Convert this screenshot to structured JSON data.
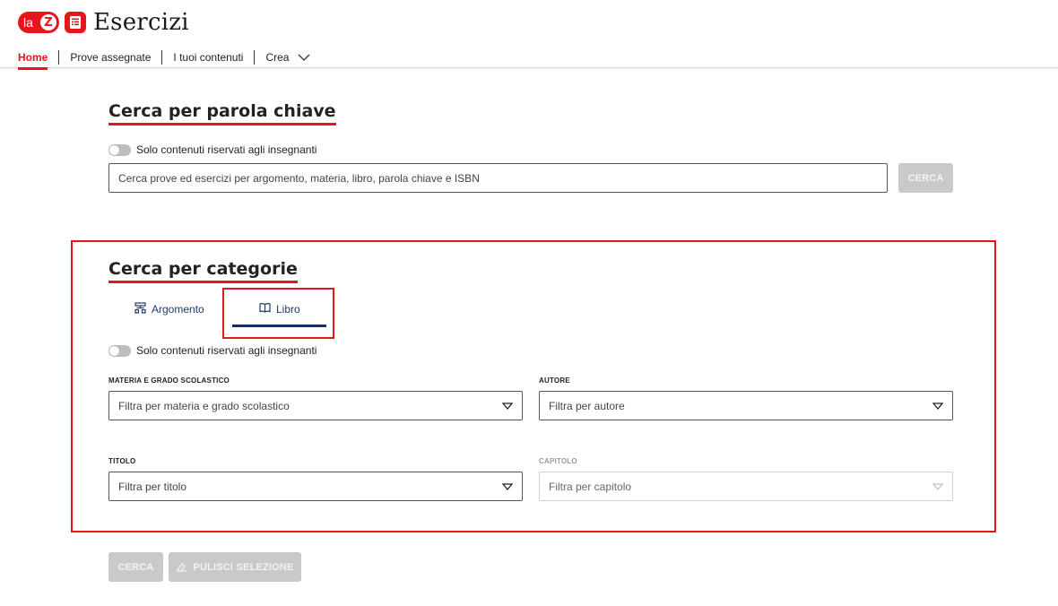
{
  "app": {
    "logo_la": "la",
    "logo_z": "Z",
    "title": "Esercizi"
  },
  "nav": {
    "items": [
      {
        "label": "Home",
        "active": true
      },
      {
        "label": "Prove assegnate"
      },
      {
        "label": "I tuoi contenuti"
      },
      {
        "label": "Crea",
        "icon": "chevron-down-icon"
      }
    ]
  },
  "keyword_section": {
    "heading": "Cerca per parola chiave",
    "toggle_label": "Solo contenuti riservati agli insegnanti",
    "search_placeholder": "Cerca prove ed esercizi per argomento, materia, libro, parola chiave e ISBN",
    "search_button": "CERCA"
  },
  "category_section": {
    "heading": "Cerca per categorie",
    "tabs": [
      {
        "label": "Argomento",
        "icon": "sitemap-icon"
      },
      {
        "label": "Libro",
        "icon": "book-open-icon",
        "active": true
      }
    ],
    "toggle_label": "Solo contenuti riservati agli insegnanti",
    "fields": {
      "materia": {
        "label": "MATERIA E GRADO SCOLASTICO",
        "placeholder": "Filtra per materia e grado scolastico"
      },
      "autore": {
        "label": "AUTORE",
        "placeholder": "Filtra per autore"
      },
      "titolo": {
        "label": "TITOLO",
        "placeholder": "Filtra per titolo"
      },
      "capitolo": {
        "label": "CAPITOLO",
        "placeholder": "Filtra per capitolo",
        "disabled": true
      }
    }
  },
  "actions": {
    "search_button": "CERCA",
    "clear_button": "PULISCI SELEZIONE"
  },
  "colors": {
    "brand_red": "#e3161d",
    "tab_blue": "#1e3a6e",
    "disabled_gray": "#c9c9c9"
  }
}
